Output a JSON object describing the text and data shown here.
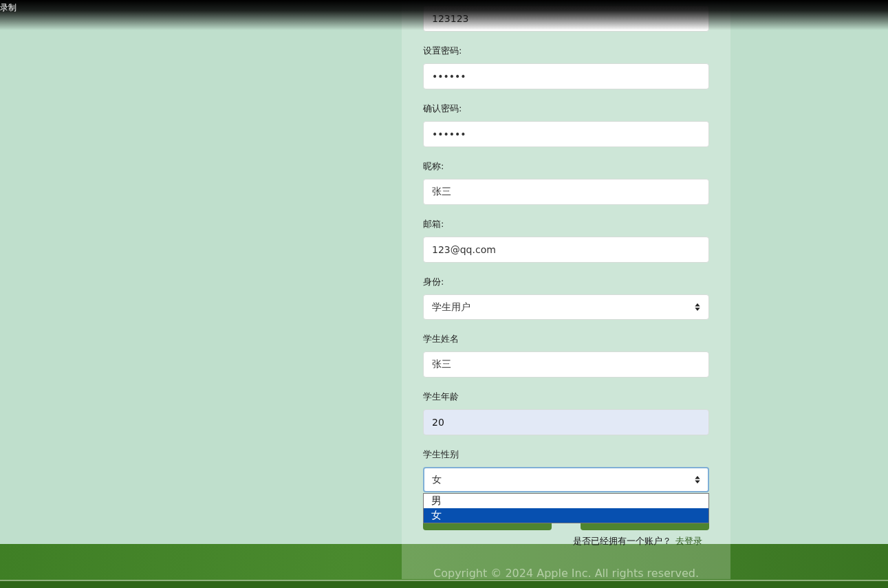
{
  "recorder_label": "录制",
  "form": {
    "fields": [
      {
        "kind": "text",
        "value": "123123"
      },
      {
        "label": "设置密码:",
        "kind": "text",
        "value": "••••••"
      },
      {
        "label": "确认密码:",
        "kind": "text",
        "value": "••••••"
      },
      {
        "label": "昵称:",
        "kind": "text",
        "value": "张三"
      },
      {
        "label": "邮箱:",
        "kind": "text",
        "value": "123@qq.com"
      },
      {
        "label": "身份:",
        "kind": "select",
        "value": "学生用户"
      },
      {
        "label": "学生姓名",
        "kind": "text",
        "value": "张三"
      },
      {
        "label": "学生年龄",
        "kind": "text",
        "value": "20",
        "autofilled": true
      },
      {
        "label": "学生性别",
        "kind": "select",
        "value": "女",
        "focused": true,
        "expanded": true,
        "options": [
          {
            "label": "男",
            "selected": false
          },
          {
            "label": "女",
            "selected": true
          }
        ]
      }
    ],
    "buttons": [
      {
        "kind": "filled"
      },
      {
        "kind": "filled"
      }
    ],
    "login_prompt": {
      "text": "是否已经拥有一个账户？",
      "link": "去登录"
    }
  },
  "footer": {
    "copyright": "Copyright © 2024 Apple Inc. All rights reserved."
  }
}
